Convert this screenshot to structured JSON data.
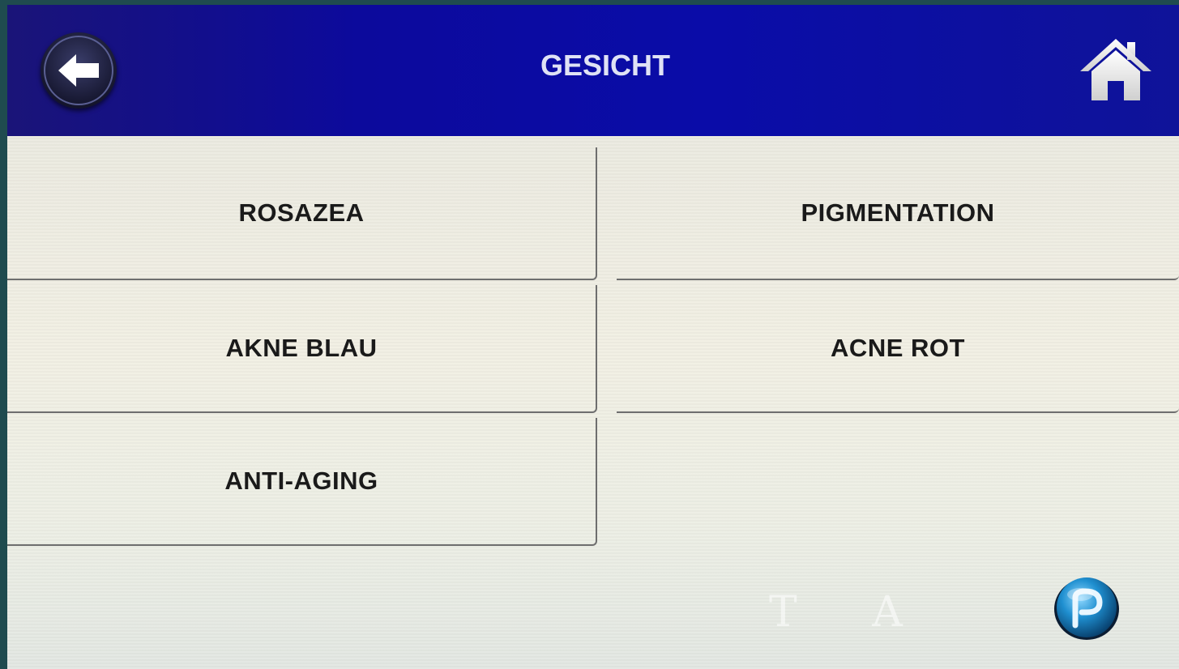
{
  "header": {
    "title": "GESICHT",
    "back_icon": "arrow-left-icon",
    "home_icon": "home-icon",
    "background_color": "#0c0a9c"
  },
  "menu": {
    "items": [
      {
        "label": "ROSAZEA"
      },
      {
        "label": "PIGMENTATION"
      },
      {
        "label": "AKNE BLAU"
      },
      {
        "label": "ACNE ROT"
      },
      {
        "label": "ANTI-AGING"
      }
    ]
  },
  "footer": {
    "watermark": "T A",
    "logo_icon": "brand-logo-icon"
  }
}
